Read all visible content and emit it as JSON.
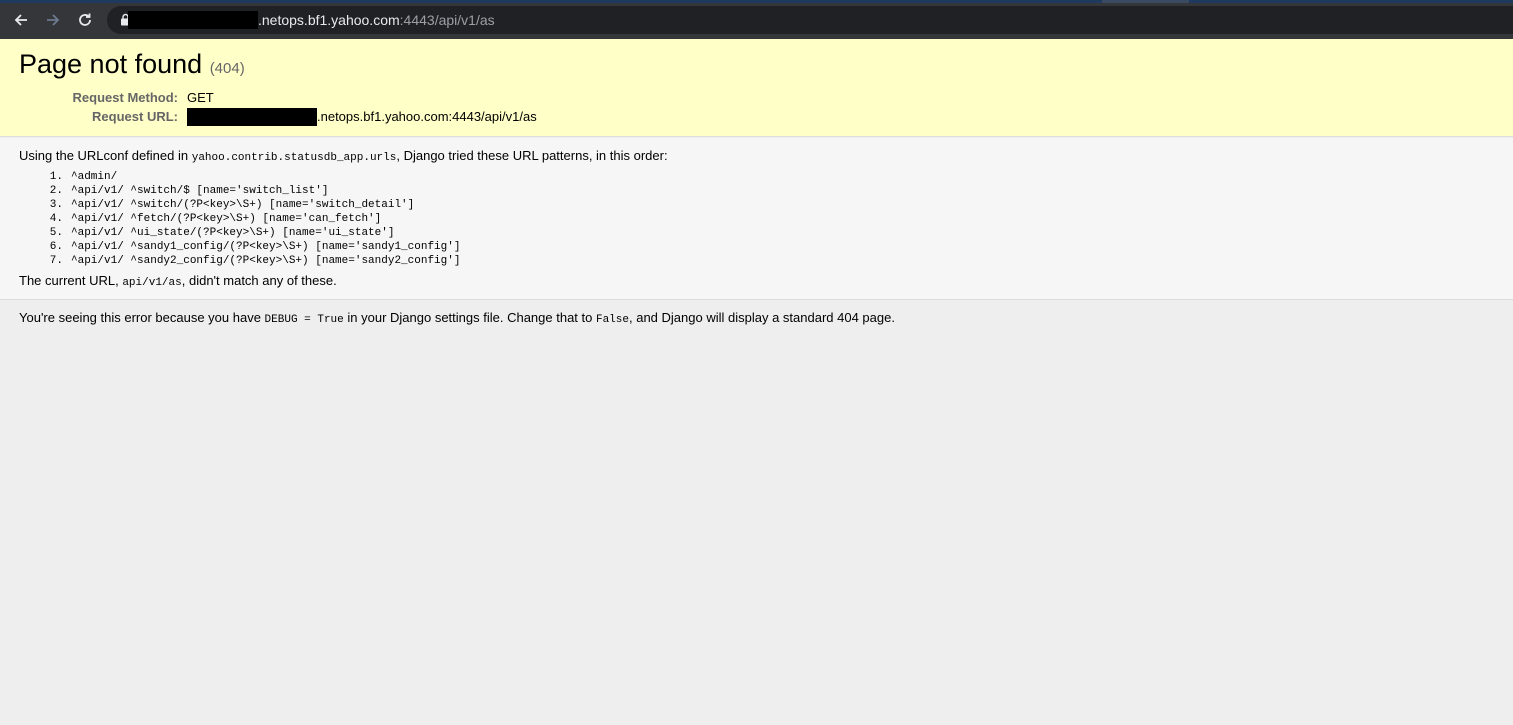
{
  "browser": {
    "url_host": ".netops.bf1.yahoo.com",
    "url_path": ":4443/api/v1/as"
  },
  "summary": {
    "title": "Page not found",
    "status_code": "(404)",
    "request_method_label": "Request Method:",
    "request_method_value": "GET",
    "request_url_label": "Request URL:",
    "request_url_value": ".netops.bf1.yahoo.com:4443/api/v1/as"
  },
  "info": {
    "intro_prefix": "Using the URLconf defined in ",
    "intro_module": "yahoo.contrib.statusdb_app.urls",
    "intro_suffix": ", Django tried these URL patterns, in this order:",
    "patterns": [
      "^admin/",
      "^api/v1/ ^switch/$ [name='switch_list']",
      "^api/v1/ ^switch/(?P<key>\\S+) [name='switch_detail']",
      "^api/v1/ ^fetch/(?P<key>\\S+) [name='can_fetch']",
      "^api/v1/ ^ui_state/(?P<key>\\S+) [name='ui_state']",
      "^api/v1/ ^sandy1_config/(?P<key>\\S+) [name='sandy1_config']",
      "^api/v1/ ^sandy2_config/(?P<key>\\S+) [name='sandy2_config']"
    ],
    "pattern_numbers": [
      "1.",
      "2.",
      "3.",
      "4.",
      "5.",
      "6.",
      "7."
    ],
    "current_prefix": "The current URL, ",
    "current_path": "api/v1/as",
    "current_suffix": ", didn't match any of these."
  },
  "explanation": {
    "prefix": "You're seeing this error because you have ",
    "debug_code": "DEBUG = True",
    "middle": " in your Django settings file. Change that to ",
    "false_code": "False",
    "suffix": ", and Django will display a standard 404 page."
  }
}
